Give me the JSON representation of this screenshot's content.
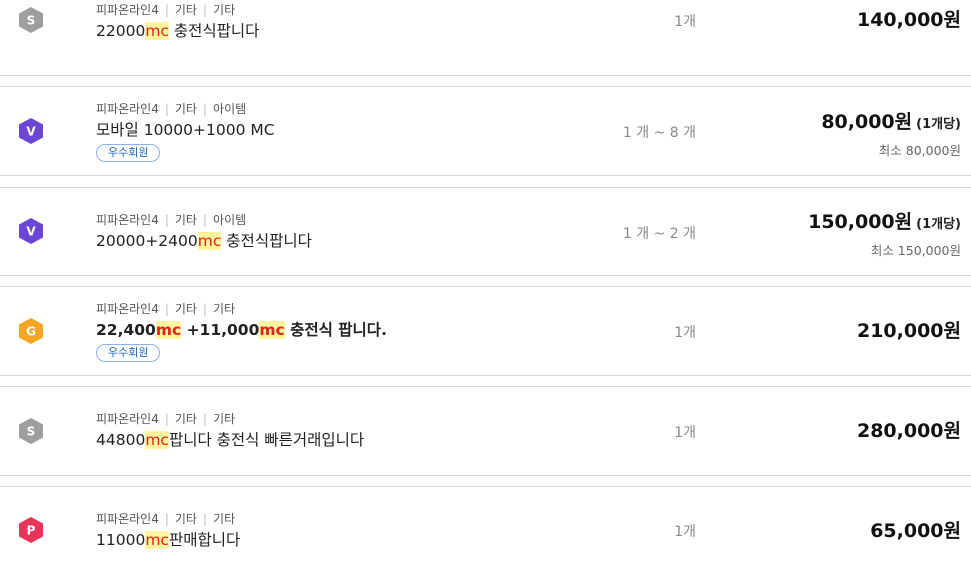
{
  "listings": [
    {
      "badge": {
        "letter": "S",
        "color": "#9e9e9e",
        "icon": "silver-seller-icon"
      },
      "category": [
        "피파온라인4",
        "기타",
        "기타"
      ],
      "title_parts": [
        {
          "t": "22000"
        },
        {
          "t": "mc",
          "hl": true
        },
        {
          "t": " 충전식팝니다"
        }
      ],
      "title_bold": false,
      "member": "",
      "qty": "1개",
      "price": "140,000원",
      "unit": "",
      "min": ""
    },
    {
      "badge": {
        "letter": "V",
        "color": "#6b45d6",
        "icon": "vip-seller-icon"
      },
      "category": [
        "피파온라인4",
        "기타",
        "아이템"
      ],
      "title_parts": [
        {
          "t": "모바일 10000+1000 MC"
        }
      ],
      "title_bold": false,
      "member": "우수회원",
      "qty": "1 개 ~ 8 개",
      "price": "80,000원",
      "unit": "(1개당)",
      "min": "최소 80,000원"
    },
    {
      "badge": {
        "letter": "V",
        "color": "#6b45d6",
        "icon": "vip-seller-icon"
      },
      "category": [
        "피파온라인4",
        "기타",
        "아이템"
      ],
      "title_parts": [
        {
          "t": "20000+2400"
        },
        {
          "t": "mc",
          "hl": true
        },
        {
          "t": " 충전식팝니다"
        }
      ],
      "title_bold": false,
      "member": "",
      "qty": "1 개 ~ 2 개",
      "price": "150,000원",
      "unit": "(1개당)",
      "min": "최소 150,000원"
    },
    {
      "badge": {
        "letter": "G",
        "color": "#f5a623",
        "icon": "gold-seller-icon"
      },
      "category": [
        "피파온라인4",
        "기타",
        "기타"
      ],
      "title_parts": [
        {
          "t": "22,400"
        },
        {
          "t": "mc",
          "hl": true
        },
        {
          "t": " +11,000"
        },
        {
          "t": "mc",
          "hl": true
        },
        {
          "t": " 충전식 팝니다."
        }
      ],
      "title_bold": true,
      "member": "우수회원",
      "qty": "1개",
      "price": "210,000원",
      "unit": "",
      "min": ""
    },
    {
      "badge": {
        "letter": "S",
        "color": "#9e9e9e",
        "icon": "silver-seller-icon"
      },
      "category": [
        "피파온라인4",
        "기타",
        "기타"
      ],
      "title_parts": [
        {
          "t": "44800"
        },
        {
          "t": "mc",
          "hl": true
        },
        {
          "t": "팝니다 충전식 빠른거래입니다"
        }
      ],
      "title_bold": false,
      "member": "",
      "qty": "1개",
      "price": "280,000원",
      "unit": "",
      "min": ""
    },
    {
      "badge": {
        "letter": "P",
        "color": "#e8345a",
        "icon": "power-seller-icon"
      },
      "category": [
        "피파온라인4",
        "기타",
        "기타"
      ],
      "title_parts": [
        {
          "t": "11000"
        },
        {
          "t": "mc",
          "hl": true
        },
        {
          "t": "판매합니다"
        }
      ],
      "title_bold": false,
      "member": "",
      "qty": "1개",
      "price": "65,000원",
      "unit": "",
      "min": ""
    }
  ]
}
